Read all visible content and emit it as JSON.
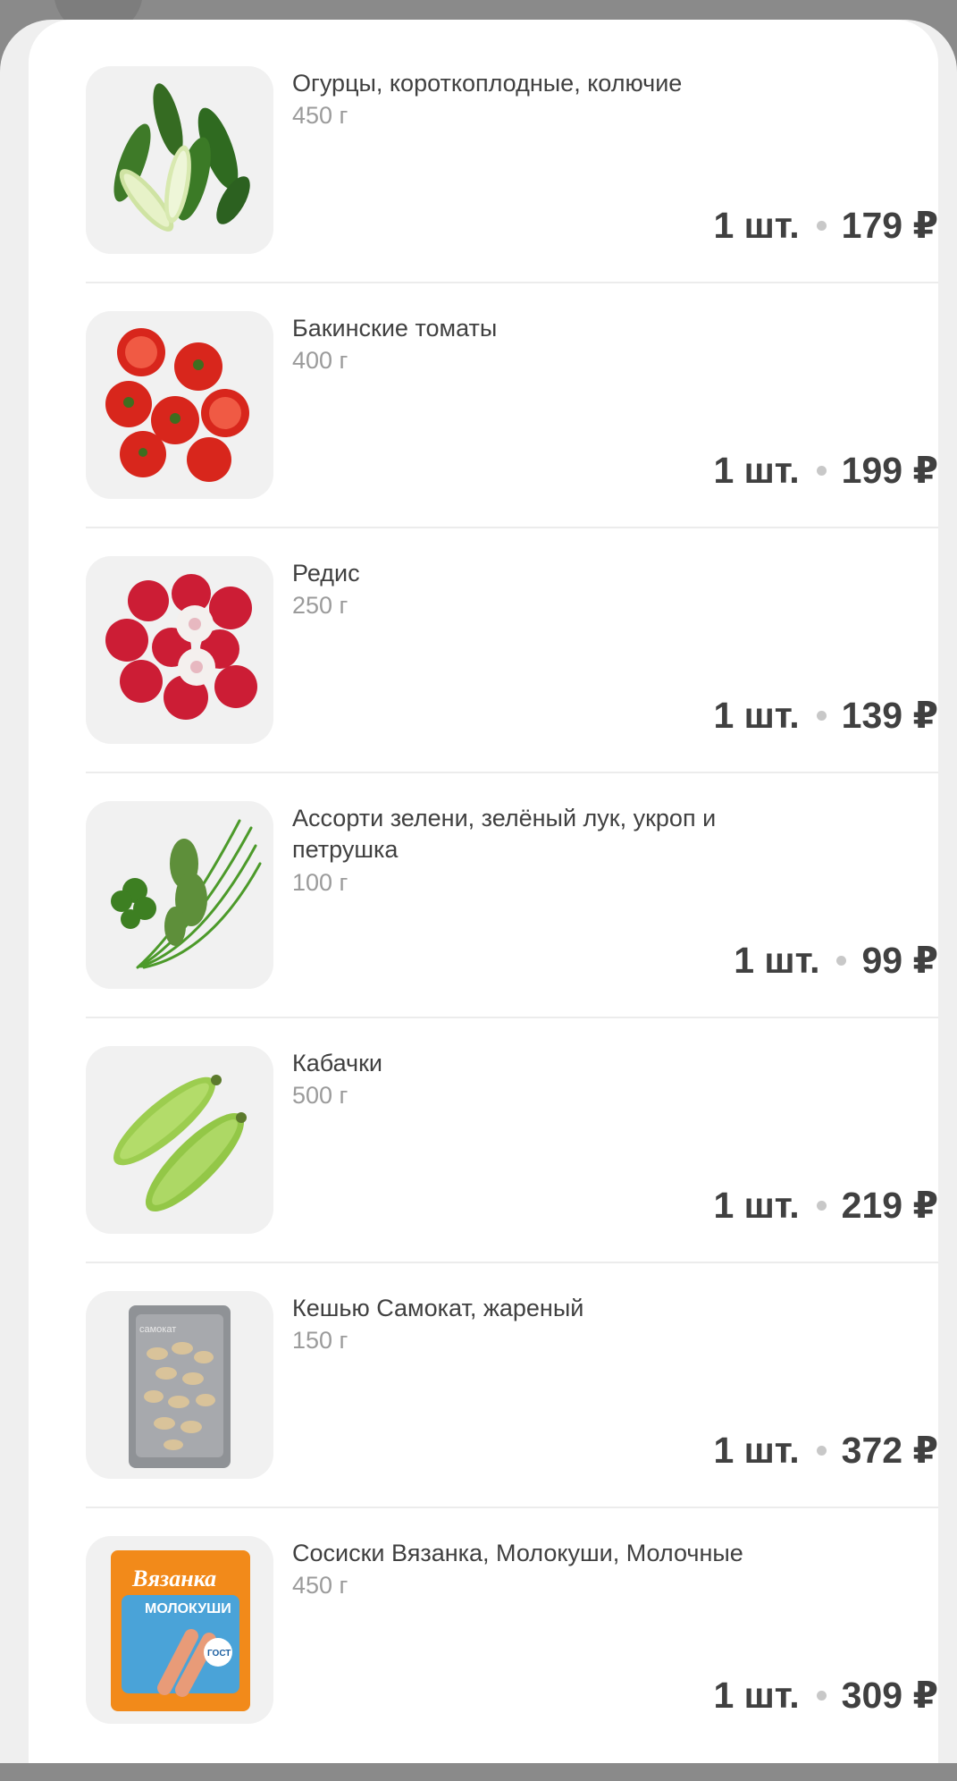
{
  "items": [
    {
      "name": "Огурцы, короткоплодные, колючие",
      "weight": "450 г",
      "qty": "1 шт.",
      "price": "179 ₽",
      "image_icon": "cucumbers-image"
    },
    {
      "name": "Бакинские томаты",
      "weight": "400 г",
      "qty": "1 шт.",
      "price": "199 ₽",
      "image_icon": "tomatoes-image"
    },
    {
      "name": "Редис",
      "weight": "250 г",
      "qty": "1 шт.",
      "price": "139 ₽",
      "image_icon": "radish-image"
    },
    {
      "name": "Ассорти зелени, зелёный лук, укроп и петрушка",
      "weight": "100 г",
      "qty": "1 шт.",
      "price": "99 ₽",
      "image_icon": "herbs-image"
    },
    {
      "name": "Кабачки",
      "weight": "500 г",
      "qty": "1 шт.",
      "price": "219 ₽",
      "image_icon": "zucchini-image"
    },
    {
      "name": "Кешью Самокат, жареный",
      "weight": "150 г",
      "qty": "1 шт.",
      "price": "372 ₽",
      "image_icon": "cashew-pack-image"
    },
    {
      "name": "Сосиски Вязанка, Молокуши, Молочные",
      "weight": "450 г",
      "qty": "1 шт.",
      "price": "309 ₽",
      "image_icon": "sausages-pack-image"
    }
  ],
  "packaging_text": {
    "cashew_brand": "самокат",
    "sausage_brand": "Вязанка",
    "sausage_product": "МОЛОКУШИ",
    "sausage_badge": "ГОСТ"
  },
  "colors": {
    "text_primary": "#404040",
    "text_secondary": "#9b9b9b",
    "sausage_pack": "#f28a1a",
    "sausage_label": "#4aa3d8"
  }
}
